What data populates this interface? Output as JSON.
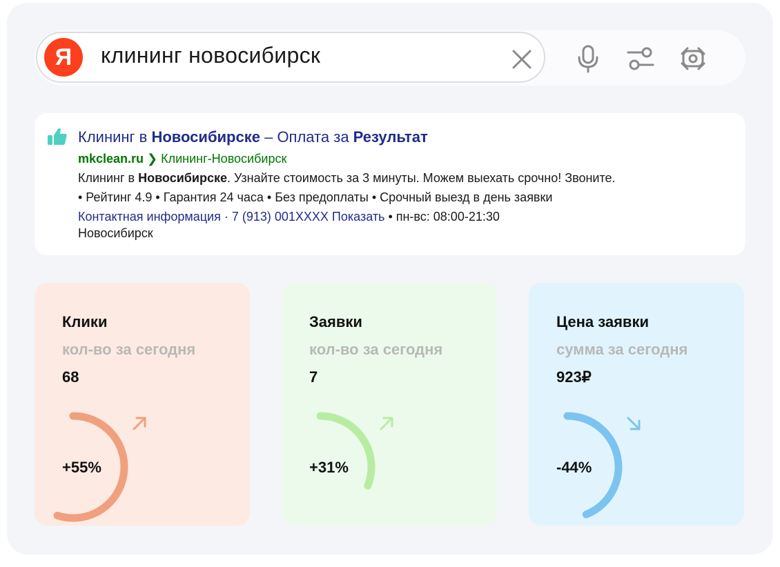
{
  "search": {
    "logo_letter": "Я",
    "query": "клининг новосибирск"
  },
  "ad": {
    "title_part1": "Клининг в ",
    "title_bold1": "Новосибирске",
    "title_part2": " – Оплата за ",
    "title_bold2": "Результат",
    "url_domain": "mkclean.ru",
    "url_sep": " ❯ ",
    "url_path": "Клининг-Новосибирск",
    "desc_part1": "Клининг в ",
    "desc_bold": "Новосибирске",
    "desc_part2": ". Узнайте стоимость за 3 минуты. Можем выехать срочно! Звоните.",
    "features": "• Рейтинг 4.9 • Гарантия 24 часа • Без предоплаты • Срочный выезд в день заявки",
    "contact_link": "Контактная информация · 7 (913) 001XXXX Показать",
    "hours": " • пн-вс: 08:00-21:30",
    "city": "Новосибирск"
  },
  "cards": [
    {
      "title": "Клики",
      "subtitle": "кол-во за сегодня",
      "value": "68",
      "change": "+55%",
      "trend": "up",
      "color": "#f0a07e",
      "bg": "#fdeae2"
    },
    {
      "title": "Заявки",
      "subtitle": "кол-во за сегодня",
      "value": "7",
      "change": "+31%",
      "trend": "up",
      "color": "#b9eca3",
      "bg": "#ecfaec"
    },
    {
      "title": "Цена заявки",
      "subtitle": "сумма за сегодня",
      "value": "923₽",
      "change": "-44%",
      "trend": "down",
      "color": "#7cc4ef",
      "bg": "#e1f4fd"
    }
  ]
}
